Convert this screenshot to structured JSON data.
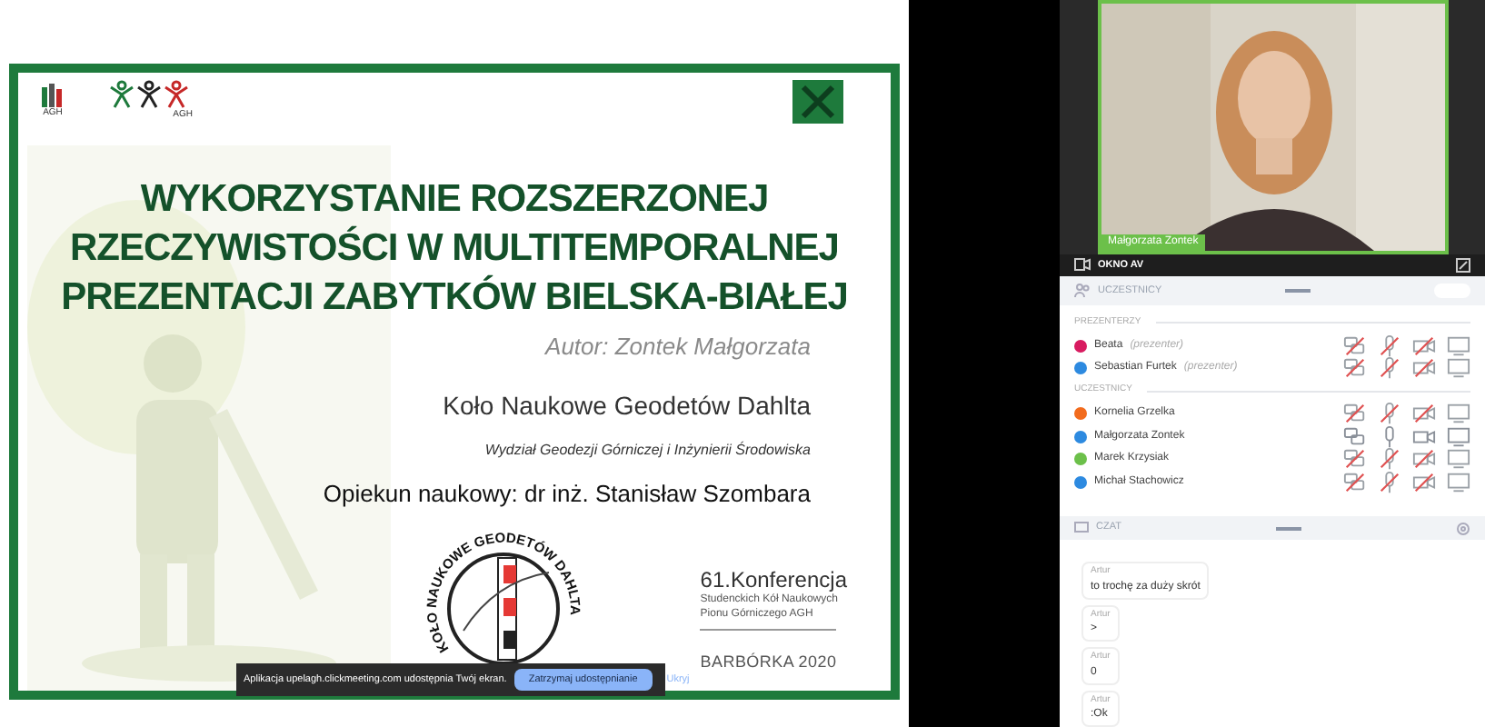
{
  "slide": {
    "logo_left": "AGH",
    "logo_right": "AGH",
    "title_lines": [
      "WYKORZYSTANIE ROZSZERZONEJ",
      "RZECZYWISTOŚCI W MULTITEMPORALNEJ",
      "PREZENTACJI ZABYTKÓW BIELSKA-BIAŁEJ"
    ],
    "author": "Autor: Zontek Małgorzata",
    "club": "Koło Naukowe Geodetów Dahlta",
    "faculty": "Wydział Geodezji Górniczej i Inżynierii Środowiska",
    "advisor": "Opiekun naukowy: dr inż. Stanisław Szombara",
    "badge_ring": "KOŁO NAUKOWE GEODETÓW DAHLTA",
    "conference": [
      "61.Konferencja",
      "Studenckich Kół Naukowych",
      "Pionu Górniczego AGH"
    ],
    "event": "BARBÓRKA 2020"
  },
  "share_bar": {
    "message": "Aplikacja upelagh.clickmeeting.com udostępnia Twój ekran.",
    "stop_button": "Zatrzymaj udostępnianie",
    "hide_link": "Ukryj"
  },
  "video": {
    "name": "Małgorzata Zontek",
    "panel_title": "OKNO AV"
  },
  "participants": {
    "title": "UCZESTNICY",
    "groups": [
      {
        "label": "PREZENTERZY",
        "people": [
          {
            "name": "Beata",
            "role": "(prezenter)",
            "color": "#d81b60",
            "muted": true
          },
          {
            "name": "Sebastian Furtek",
            "role": "(prezenter)",
            "color": "#2d8ae0",
            "muted": true
          }
        ]
      },
      {
        "label": "UCZESTNICY",
        "people": [
          {
            "name": "Kornelia Grzelka",
            "color": "#f26b1d",
            "muted": true
          },
          {
            "name": "Małgorzata Zontek",
            "color": "#2d8ae0",
            "muted": false
          },
          {
            "name": "Marek Krzysiak",
            "color": "#6cc04a",
            "muted": true
          },
          {
            "name": "Michał Stachowicz",
            "color": "#2d8ae0",
            "muted": true
          }
        ]
      }
    ]
  },
  "chat": {
    "title": "CZAT",
    "messages": [
      {
        "author": "Artur",
        "text": "to trochę za duży skrót"
      },
      {
        "author": "Artur",
        "text": ">"
      },
      {
        "author": "Artur",
        "text": "0"
      },
      {
        "author": "Artur",
        "text": ":Ok"
      }
    ]
  }
}
